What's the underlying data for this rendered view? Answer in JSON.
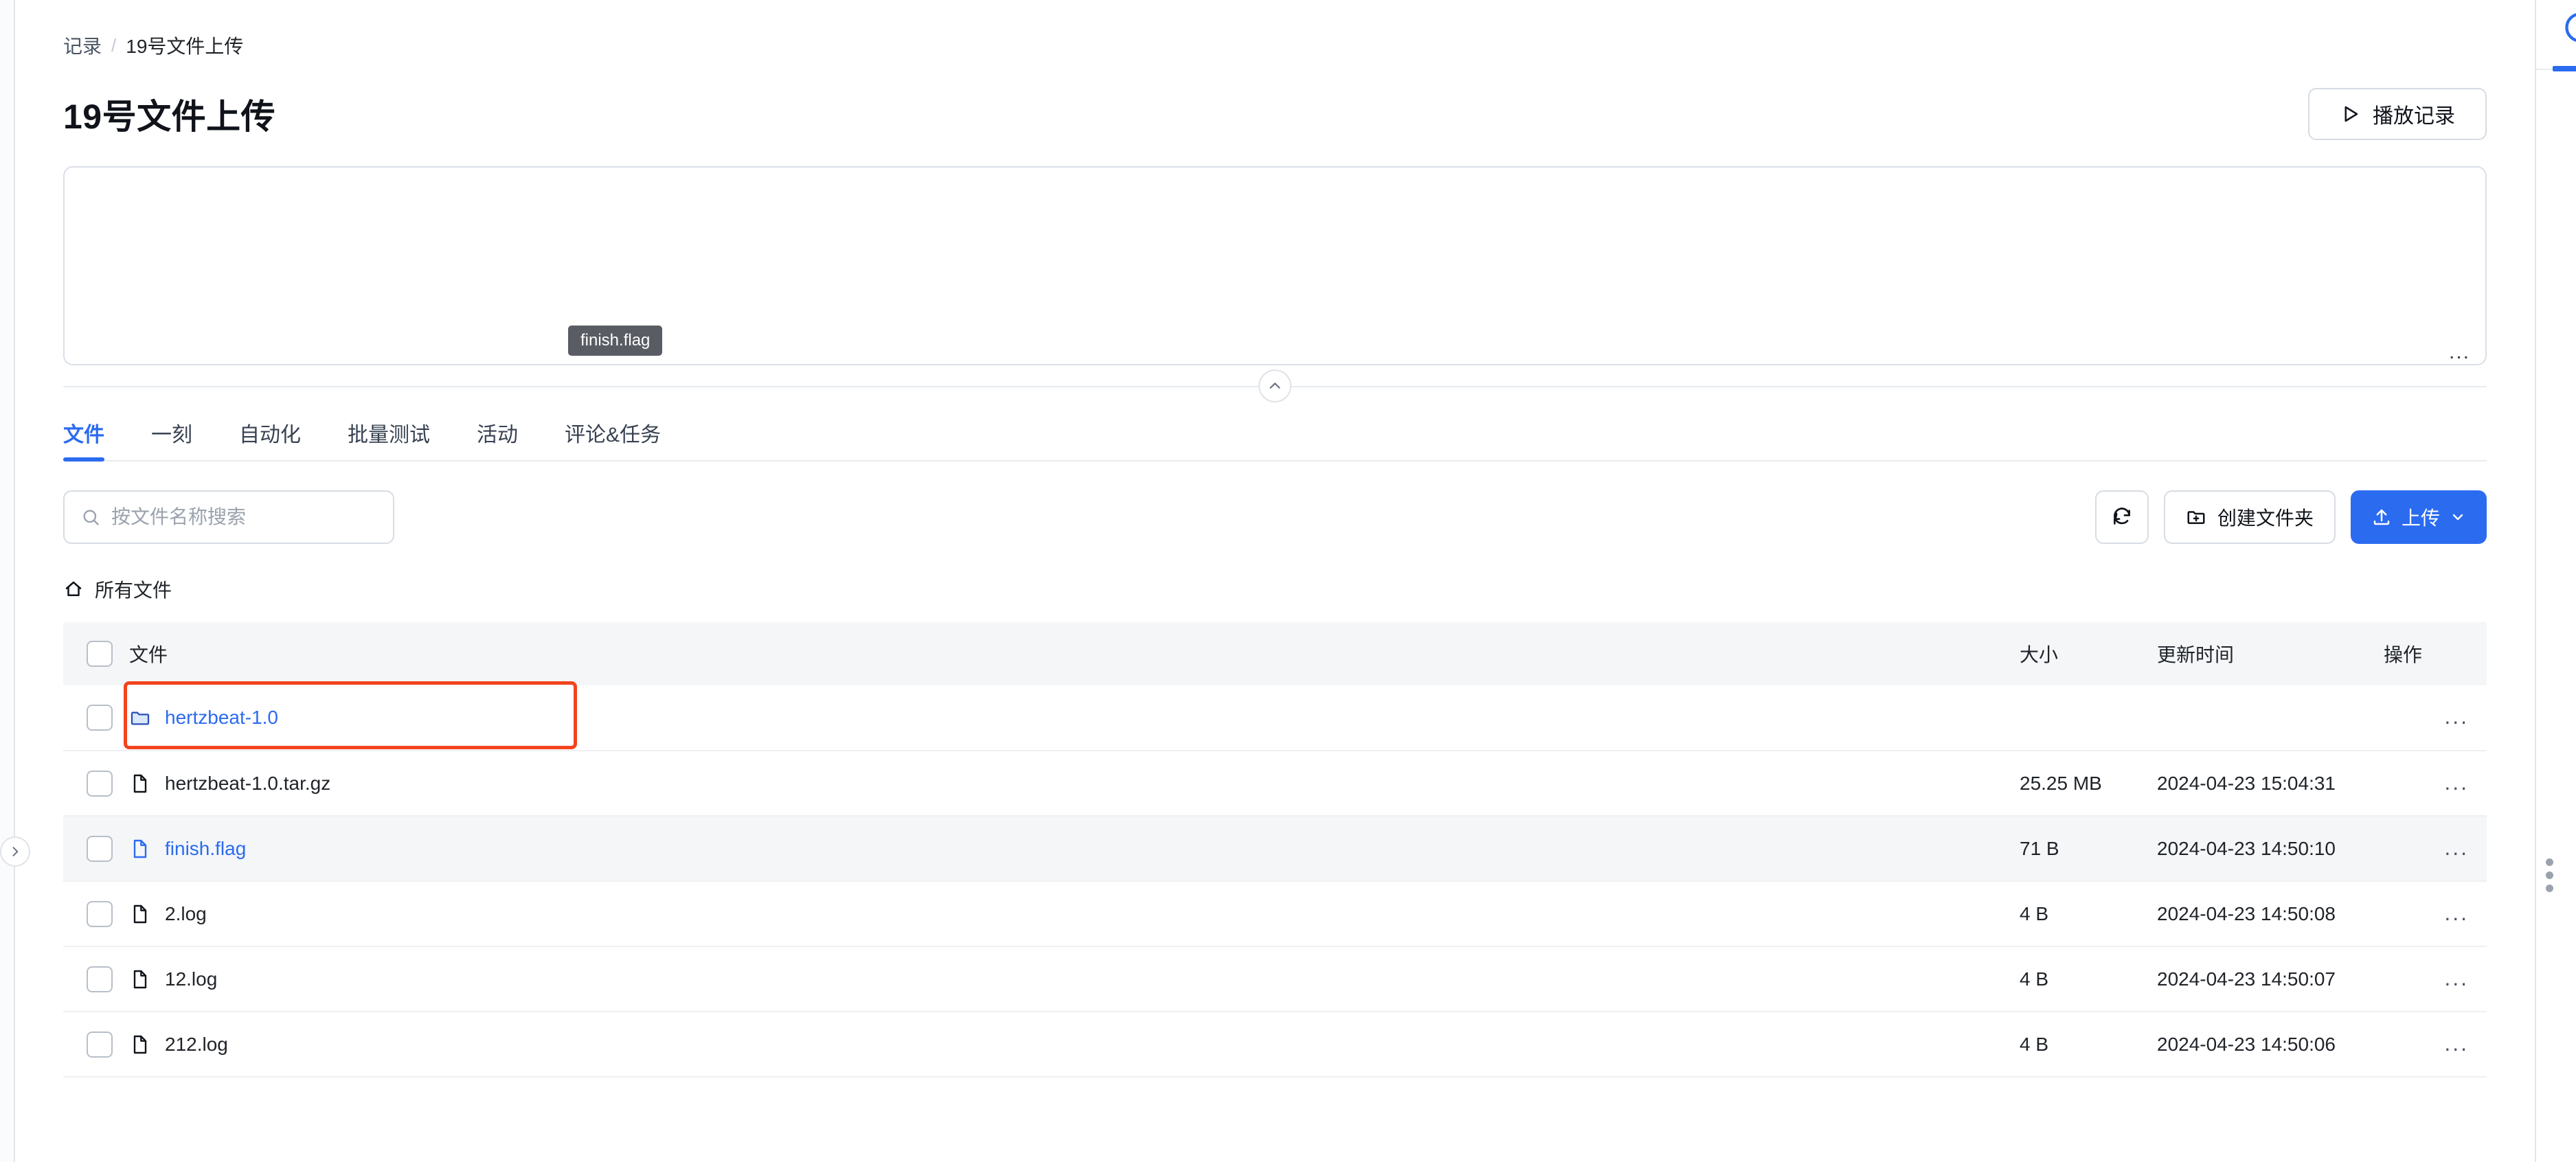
{
  "breadcrumb": {
    "root": "记录",
    "separator": "/",
    "current": "19号文件上传"
  },
  "header": {
    "title": "19号文件上传",
    "play_button": {
      "label": "播放记录",
      "icon": "play-icon"
    }
  },
  "preview": {
    "tooltip": "finish.flag",
    "ellipsis": "...",
    "collapse_icon": "chevron-up-icon"
  },
  "tabs": [
    {
      "label": "文件",
      "active": true
    },
    {
      "label": "一刻",
      "active": false
    },
    {
      "label": "自动化",
      "active": false
    },
    {
      "label": "批量测试",
      "active": false
    },
    {
      "label": "活动",
      "active": false
    },
    {
      "label": "评论&任务",
      "active": false
    }
  ],
  "toolbar": {
    "search": {
      "placeholder": "按文件名称搜索",
      "value": "",
      "icon": "search-icon"
    },
    "refresh": {
      "icon": "refresh-icon"
    },
    "new_folder": {
      "label": "创建文件夹",
      "icon": "folder-plus-icon"
    },
    "upload": {
      "label": "上传",
      "icon": "upload-icon",
      "chevron": "chevron-down-icon"
    }
  },
  "pathbar": {
    "label": "所有文件",
    "icon": "home-icon"
  },
  "table": {
    "columns": {
      "name": "文件",
      "size": "大小",
      "time": "更新时间",
      "action": "操作"
    },
    "rows": [
      {
        "name": "hertzbeat-1.0",
        "kind": "folder",
        "link": true,
        "size": "",
        "time": "",
        "action": "...",
        "annotated": true,
        "hovered": false
      },
      {
        "name": "hertzbeat-1.0.tar.gz",
        "kind": "file",
        "link": false,
        "size": "25.25 MB",
        "time": "2024-04-23 15:04:31",
        "action": "...",
        "annotated": false,
        "hovered": false
      },
      {
        "name": "finish.flag",
        "kind": "file",
        "link": true,
        "size": "71 B",
        "time": "2024-04-23 14:50:10",
        "action": "...",
        "annotated": false,
        "hovered": true
      },
      {
        "name": "2.log",
        "kind": "file",
        "link": false,
        "size": "4 B",
        "time": "2024-04-23 14:50:08",
        "action": "...",
        "annotated": false,
        "hovered": false
      },
      {
        "name": "12.log",
        "kind": "file",
        "link": false,
        "size": "4 B",
        "time": "2024-04-23 14:50:07",
        "action": "...",
        "annotated": false,
        "hovered": false
      },
      {
        "name": "212.log",
        "kind": "file",
        "link": false,
        "size": "4 B",
        "time": "2024-04-23 14:50:06",
        "action": "...",
        "annotated": false,
        "hovered": false
      }
    ]
  },
  "left_rail": {
    "expand_icon": "chevron-right-icon"
  },
  "right_panel": {
    "info_icon": "info-circle-icon",
    "drag_handle_icon": "drag-dots-icon"
  },
  "colors": {
    "accent_blue": "#2b6bf0",
    "annotation_orange": "#f2441d",
    "row_hover": "#f4f6f8",
    "tooltip_bg": "#595d63",
    "border": "#d7dce3"
  }
}
